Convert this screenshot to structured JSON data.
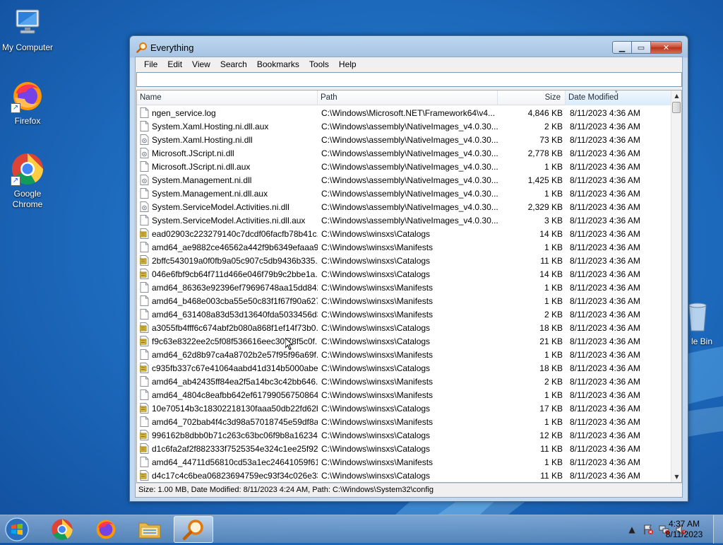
{
  "desktop": {
    "icons": [
      {
        "label": "My Computer",
        "icon": "computer-icon"
      },
      {
        "label": "Firefox",
        "icon": "firefox-icon"
      },
      {
        "label": "Google Chrome",
        "icon": "chrome-icon"
      },
      {
        "label": "le Bin",
        "icon": "recycle-bin-icon"
      }
    ]
  },
  "window": {
    "title": "Everything",
    "menu": [
      "File",
      "Edit",
      "View",
      "Search",
      "Bookmarks",
      "Tools",
      "Help"
    ],
    "search": {
      "value": ""
    },
    "columns": {
      "name": "Name",
      "path": "Path",
      "size": "Size",
      "date": "Date Modified"
    },
    "rows": [
      {
        "name": "ngen_service.log",
        "path": "C:\\Windows\\Microsoft.NET\\Framework64\\v4...",
        "size": "4,846 KB",
        "date": "8/11/2023 4:36 AM",
        "icon": "doc"
      },
      {
        "name": "System.Xaml.Hosting.ni.dll.aux",
        "path": "C:\\Windows\\assembly\\NativeImages_v4.0.30...",
        "size": "2 KB",
        "date": "8/11/2023 4:36 AM",
        "icon": "doc"
      },
      {
        "name": "System.Xaml.Hosting.ni.dll",
        "path": "C:\\Windows\\assembly\\NativeImages_v4.0.30...",
        "size": "73 KB",
        "date": "8/11/2023 4:36 AM",
        "icon": "dll"
      },
      {
        "name": "Microsoft.JScript.ni.dll",
        "path": "C:\\Windows\\assembly\\NativeImages_v4.0.30...",
        "size": "2,778 KB",
        "date": "8/11/2023 4:36 AM",
        "icon": "dll"
      },
      {
        "name": "Microsoft.JScript.ni.dll.aux",
        "path": "C:\\Windows\\assembly\\NativeImages_v4.0.30...",
        "size": "1 KB",
        "date": "8/11/2023 4:36 AM",
        "icon": "doc"
      },
      {
        "name": "System.Management.ni.dll",
        "path": "C:\\Windows\\assembly\\NativeImages_v4.0.30...",
        "size": "1,425 KB",
        "date": "8/11/2023 4:36 AM",
        "icon": "dll"
      },
      {
        "name": "System.Management.ni.dll.aux",
        "path": "C:\\Windows\\assembly\\NativeImages_v4.0.30...",
        "size": "1 KB",
        "date": "8/11/2023 4:36 AM",
        "icon": "doc"
      },
      {
        "name": "System.ServiceModel.Activities.ni.dll",
        "path": "C:\\Windows\\assembly\\NativeImages_v4.0.30...",
        "size": "2,329 KB",
        "date": "8/11/2023 4:36 AM",
        "icon": "dll"
      },
      {
        "name": "System.ServiceModel.Activities.ni.dll.aux",
        "path": "C:\\Windows\\assembly\\NativeImages_v4.0.30...",
        "size": "3 KB",
        "date": "8/11/2023 4:36 AM",
        "icon": "doc"
      },
      {
        "name": "ead02903c223279140c7dcdf06facfb78b41c...",
        "path": "C:\\Windows\\winsxs\\Catalogs",
        "size": "14 KB",
        "date": "8/11/2023 4:36 AM",
        "icon": "cat"
      },
      {
        "name": "amd64_ae9882ce46562a442f9b6349efaaa9...",
        "path": "C:\\Windows\\winsxs\\Manifests",
        "size": "1 KB",
        "date": "8/11/2023 4:36 AM",
        "icon": "doc"
      },
      {
        "name": "2bffc543019a0f0fb9a05c907c5db9436b335...",
        "path": "C:\\Windows\\winsxs\\Catalogs",
        "size": "11 KB",
        "date": "8/11/2023 4:36 AM",
        "icon": "cat"
      },
      {
        "name": "046e6fbf9cb64f711d466e046f79b9c2bbe1a...",
        "path": "C:\\Windows\\winsxs\\Catalogs",
        "size": "14 KB",
        "date": "8/11/2023 4:36 AM",
        "icon": "cat"
      },
      {
        "name": "amd64_86363e92396ef79696748aa15dd842...",
        "path": "C:\\Windows\\winsxs\\Manifests",
        "size": "1 KB",
        "date": "8/11/2023 4:36 AM",
        "icon": "doc"
      },
      {
        "name": "amd64_b468e003cba55e50c83f1f67f90a627...",
        "path": "C:\\Windows\\winsxs\\Manifests",
        "size": "1 KB",
        "date": "8/11/2023 4:36 AM",
        "icon": "doc"
      },
      {
        "name": "amd64_631408a83d53d13640fda5033456d3...",
        "path": "C:\\Windows\\winsxs\\Manifests",
        "size": "2 KB",
        "date": "8/11/2023 4:36 AM",
        "icon": "doc"
      },
      {
        "name": "a3055fb4fff6c674abf2b080a868f1ef14f73b0...",
        "path": "C:\\Windows\\winsxs\\Catalogs",
        "size": "18 KB",
        "date": "8/11/2023 4:36 AM",
        "icon": "cat"
      },
      {
        "name": "f9c63e8322ee2c5f08f536616eec30f78f5c0f...",
        "path": "C:\\Windows\\winsxs\\Catalogs",
        "size": "21 KB",
        "date": "8/11/2023 4:36 AM",
        "icon": "cat"
      },
      {
        "name": "amd64_62d8b97ca4a8702b2e57f95f96a69f...",
        "path": "C:\\Windows\\winsxs\\Manifests",
        "size": "1 KB",
        "date": "8/11/2023 4:36 AM",
        "icon": "doc"
      },
      {
        "name": "c935fb337c67e41064aabd41d314b5000abe...",
        "path": "C:\\Windows\\winsxs\\Catalogs",
        "size": "18 KB",
        "date": "8/11/2023 4:36 AM",
        "icon": "cat"
      },
      {
        "name": "amd64_ab42435ff84ea2f5a14bc3c42bb646...",
        "path": "C:\\Windows\\winsxs\\Manifests",
        "size": "2 KB",
        "date": "8/11/2023 4:36 AM",
        "icon": "doc"
      },
      {
        "name": "amd64_4804c8eafbb642ef61799056750864...",
        "path": "C:\\Windows\\winsxs\\Manifests",
        "size": "1 KB",
        "date": "8/11/2023 4:36 AM",
        "icon": "doc"
      },
      {
        "name": "10e70514b3c18302218130faaa50db22fd62b...",
        "path": "C:\\Windows\\winsxs\\Catalogs",
        "size": "17 KB",
        "date": "8/11/2023 4:36 AM",
        "icon": "cat"
      },
      {
        "name": "amd64_702bab4f4c3d98a57018745e59df8a...",
        "path": "C:\\Windows\\winsxs\\Manifests",
        "size": "1 KB",
        "date": "8/11/2023 4:36 AM",
        "icon": "doc"
      },
      {
        "name": "996162b8dbb0b71c263c63bc06f9b8a16234...",
        "path": "C:\\Windows\\winsxs\\Catalogs",
        "size": "12 KB",
        "date": "8/11/2023 4:36 AM",
        "icon": "cat"
      },
      {
        "name": "d1c6fa2af2f882333f7525354e324c1ee25f92...",
        "path": "C:\\Windows\\winsxs\\Catalogs",
        "size": "11 KB",
        "date": "8/11/2023 4:36 AM",
        "icon": "cat"
      },
      {
        "name": "amd64_44711d56810cd53a1ec24641059f61...",
        "path": "C:\\Windows\\winsxs\\Manifests",
        "size": "1 KB",
        "date": "8/11/2023 4:36 AM",
        "icon": "doc"
      },
      {
        "name": "d4c17c4c6bea06823694759ec93f34c026e33...",
        "path": "C:\\Windows\\winsxs\\Catalogs",
        "size": "11 KB",
        "date": "8/11/2023 4:36 AM",
        "icon": "cat"
      }
    ],
    "status": "Size: 1.00 MB, Date Modified: 8/11/2023 4:24 AM, Path: C:\\Windows\\System32\\config"
  },
  "taskbar": {
    "items": [
      {
        "name": "taskbar-chrome",
        "icon": "chrome-icon"
      },
      {
        "name": "taskbar-firefox",
        "icon": "firefox-icon"
      },
      {
        "name": "taskbar-explorer",
        "icon": "folder-icon"
      },
      {
        "name": "taskbar-everything",
        "icon": "magnifier-icon",
        "active": true
      }
    ],
    "clock": {
      "time": "4:37 AM",
      "date": "8/11/2023"
    }
  },
  "colors": {
    "accent": "#3399ff",
    "selection": "#cce8ff"
  }
}
